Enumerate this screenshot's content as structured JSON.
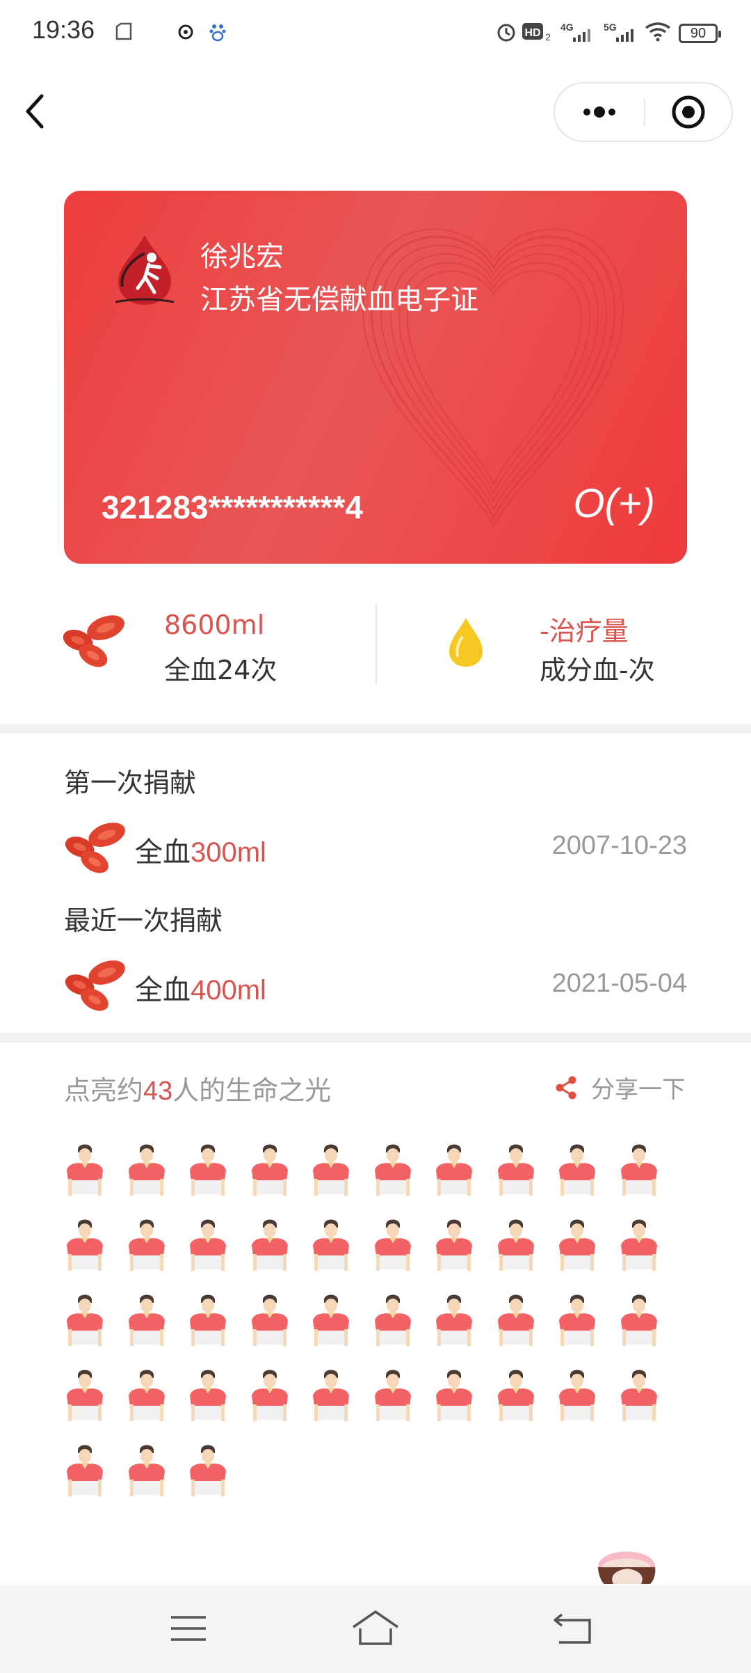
{
  "status_bar": {
    "time": "19:36",
    "battery": "90",
    "icons": [
      "clipboard-icon",
      "alarm-app-icon",
      "baidu-icon",
      "alarm-clock-icon",
      "hd-icon",
      "signal-4g-icon",
      "signal-5g-icon",
      "wifi-icon",
      "battery-icon"
    ]
  },
  "nav": {
    "back_icon": "chevron-left-icon",
    "more_icon": "more-dots-icon",
    "close_icon": "target-close-icon"
  },
  "card": {
    "name": "徐兆宏",
    "title": "江苏省无偿献血电子证",
    "id_number": "321283***********4",
    "blood_type": "O(+)",
    "logo_icon": "blood-donor-logo-icon",
    "colors": {
      "card_start": "#ee3d3d",
      "card_end": "#ee3a3a"
    }
  },
  "stats": {
    "whole_blood": {
      "value": "8600ml",
      "label": "全血24次",
      "icon": "red-blood-cells-icon"
    },
    "component": {
      "value": "-治疗量",
      "label": "成分血-次",
      "icon": "yellow-drop-icon"
    }
  },
  "first_donation": {
    "label": "第一次捐献",
    "type": "全血",
    "amount": "300ml",
    "date": "2007-10-23"
  },
  "latest_donation": {
    "label": "最近一次捐献",
    "type": "全血",
    "amount": "400ml",
    "date": "2021-05-04"
  },
  "lives": {
    "prefix": "点亮约",
    "count": "43",
    "suffix": "人的生命之光",
    "share_label": "分享一下",
    "person_count": 43,
    "person_icon": "person-icon"
  },
  "bottom_nav": {
    "menu_icon": "menu-icon",
    "home_icon": "home-icon",
    "back_icon": "back-arrow-icon"
  },
  "colors": {
    "accent": "#d9534f",
    "muted": "#999999",
    "text": "#333333",
    "separator": "#f2f2f2"
  }
}
